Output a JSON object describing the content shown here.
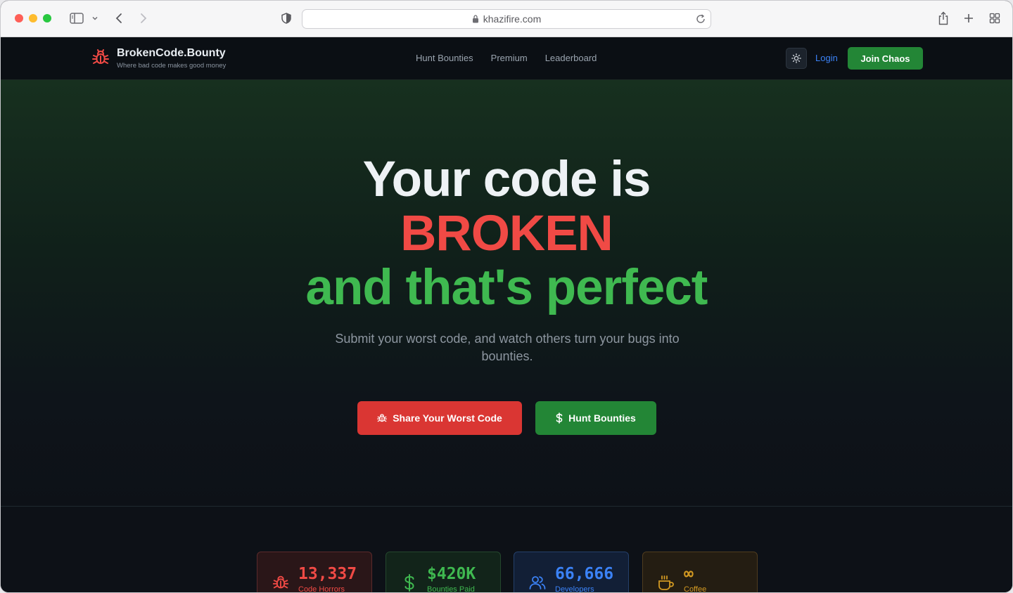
{
  "browser": {
    "url": "khazifire.com"
  },
  "header": {
    "brand_title": "BrokenCode.Bounty",
    "brand_tagline": "Where bad code makes good money",
    "nav": [
      "Hunt Bounties",
      "Premium",
      "Leaderboard"
    ],
    "login_label": "Login",
    "join_label": "Join Chaos"
  },
  "hero": {
    "line1": "Your code is",
    "line2": "BROKEN",
    "line3": "and that's perfect",
    "subtitle": "Submit your worst code, and watch others turn your bugs into bounties.",
    "cta_primary": "Share Your Worst Code",
    "cta_secondary": "Hunt Bounties"
  },
  "stats": [
    {
      "value": "13,337",
      "label": "Code Horrors",
      "icon": "bug-icon"
    },
    {
      "value": "$420K",
      "label": "Bounties Paid",
      "icon": "dollar-icon"
    },
    {
      "value": "66,666",
      "label": "Developers",
      "icon": "users-icon"
    },
    {
      "value": "∞",
      "label": "Coffee",
      "icon": "coffee-icon"
    }
  ],
  "colors": {
    "red": "#f04a45",
    "green": "#3fb950",
    "blue": "#3b82f6",
    "amber": "#d29922",
    "background": "#0d1117"
  }
}
